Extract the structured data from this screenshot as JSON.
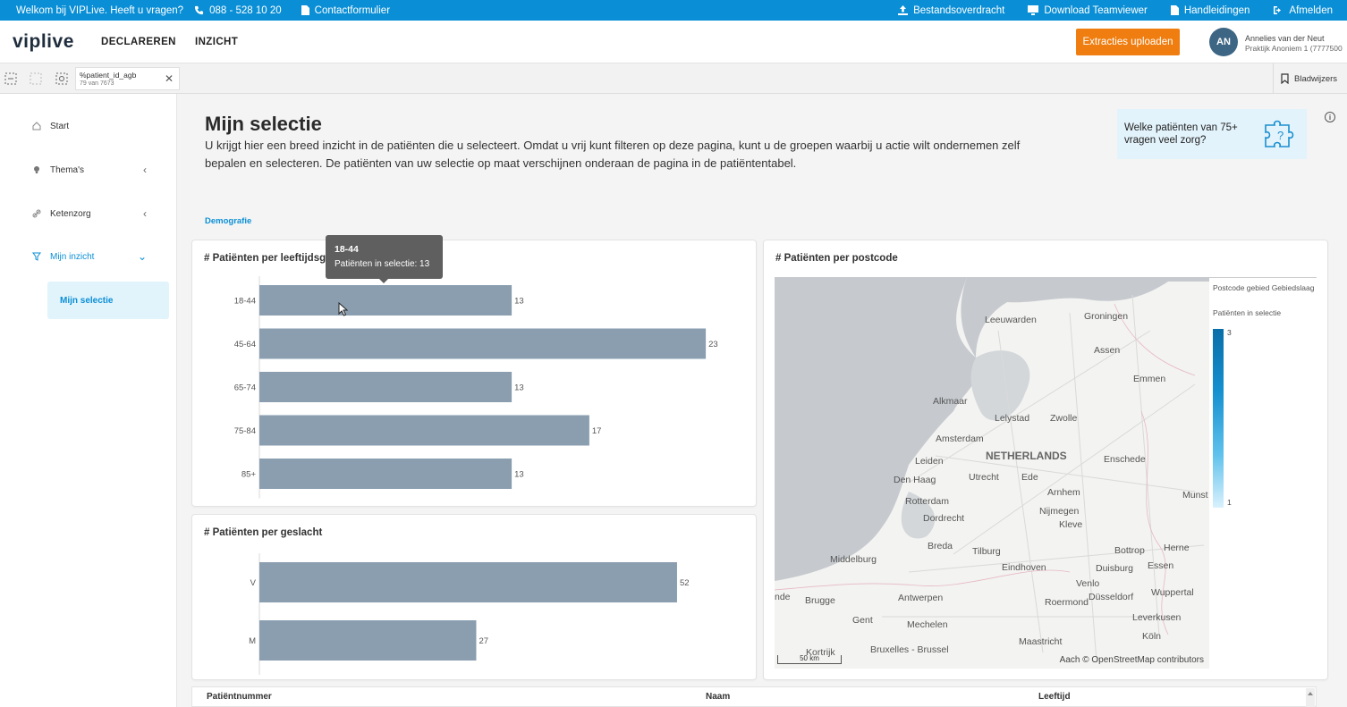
{
  "topbar": {
    "welcome": "Welkom bij VIPLive. Heeft u vragen?",
    "phone": "088 - 528 10 20",
    "contact": "Contactformulier",
    "file_transfer": "Bestandsoverdracht",
    "teamviewer": "Download Teamviewer",
    "manuals": "Handleidingen",
    "logout": "Afmelden"
  },
  "header": {
    "logo": "viplive",
    "nav": [
      "DECLAREREN",
      "INZICHT"
    ],
    "upload_button": "Extracties uploaden",
    "avatar_initials": "AN",
    "user_name": "Annelies van der Neut",
    "user_org": "Praktijk Anoniem 1 (7777500"
  },
  "toolbar": {
    "filter_field": "%patient_id_agb",
    "filter_count": "79 van 7673",
    "bookmarks": "Bladwijzers"
  },
  "sidebar": {
    "items": [
      {
        "label": "Start",
        "icon": "home-icon"
      },
      {
        "label": "Thema's",
        "icon": "bulb-icon"
      },
      {
        "label": "Ketenzorg",
        "icon": "link-icon"
      },
      {
        "label": "Mijn inzicht",
        "icon": "filter-icon"
      }
    ],
    "sub_item": "Mijn selectie"
  },
  "main": {
    "title": "Mijn selectie",
    "description": "U krijgt hier een breed inzicht in de patiënten die u selecteert. Omdat u vrij kunt filteren op deze pagina, kunt u de groepen waarbij u actie wilt ondernemen zelf bepalen en selecteren. De patiënten van uw selectie op maat verschijnen onderaan de pagina in de patiëntentabel.",
    "info_card": "Welke patiënten van 75+ vragen veel zorg?",
    "tab": "Demografie"
  },
  "age_chart": {
    "title": "# Patiënten per leeftijdsg",
    "tooltip_title": "18-44",
    "tooltip_body": "Patiënten in selectie: 13"
  },
  "gender_chart": {
    "title": "# Patiënten per geslacht"
  },
  "map_panel": {
    "title": "# Patiënten per postcode",
    "legend_title": "Postcode gebied Gebiedslaag",
    "legend_measure": "Patiënten in selectie",
    "legend_max": "3",
    "legend_min": "1",
    "scale": "50 km",
    "attribution": "Aach © OpenStreetMap contributors",
    "places": {
      "leeuwarden": "Leeuwarden",
      "groningen": "Groningen",
      "assen": "Assen",
      "emmen": "Emmen",
      "alkmaar": "Alkmaar",
      "lelystad": "Lelystad",
      "zwolle": "Zwolle",
      "amsterdam": "Amsterdam",
      "netherlands": "NETHERLANDS",
      "leiden": "Leiden",
      "enschede": "Enschede",
      "denhaag": "Den Haag",
      "utrecht": "Utrecht",
      "ede": "Ede",
      "arnhem": "Arnhem",
      "rotterdam": "Rotterdam",
      "nijmegen": "Nijmegen",
      "munst": "Munst",
      "dordrecht": "Dordrecht",
      "kleve": "Kleve",
      "breda": "Breda",
      "tilburg": "Tilburg",
      "bottrop": "Bottrop",
      "herne": "Herne",
      "middelburg": "Middelburg",
      "eindhoven": "Eindhoven",
      "duisburg": "Duisburg",
      "essen": "Essen",
      "venlo": "Venlo",
      "wuppertal": "Wuppertal",
      "brugge": "Brugge",
      "antwerpen": "Antwerpen",
      "dusseldorf": "Düsseldorf",
      "roermond": "Roermond",
      "gent": "Gent",
      "leverkusen": "Leverkusen",
      "mechelen": "Mechelen",
      "kortrijk": "Kortrijk",
      "koln": "Köln",
      "bruxelles": "Bruxelles - Brussel",
      "maastricht": "Maastricht",
      "nde": "nde"
    }
  },
  "table": {
    "columns": [
      "Patiëntnummer",
      "Naam",
      "Leeftijd"
    ]
  },
  "chart_data": [
    {
      "type": "bar",
      "orientation": "horizontal",
      "title": "# Patiënten per leeftijdsg",
      "categories": [
        "18-44",
        "45-64",
        "65-74",
        "75-84",
        "85+"
      ],
      "values": [
        13,
        23,
        13,
        17,
        13
      ],
      "color": "#8a9eb0",
      "xlim": [
        0,
        26
      ]
    },
    {
      "type": "bar",
      "orientation": "horizontal",
      "title": "# Patiënten per geslacht",
      "categories": [
        "V",
        "M"
      ],
      "values": [
        52,
        27
      ],
      "color": "#8a9eb0",
      "xlim": [
        0,
        55
      ]
    }
  ]
}
